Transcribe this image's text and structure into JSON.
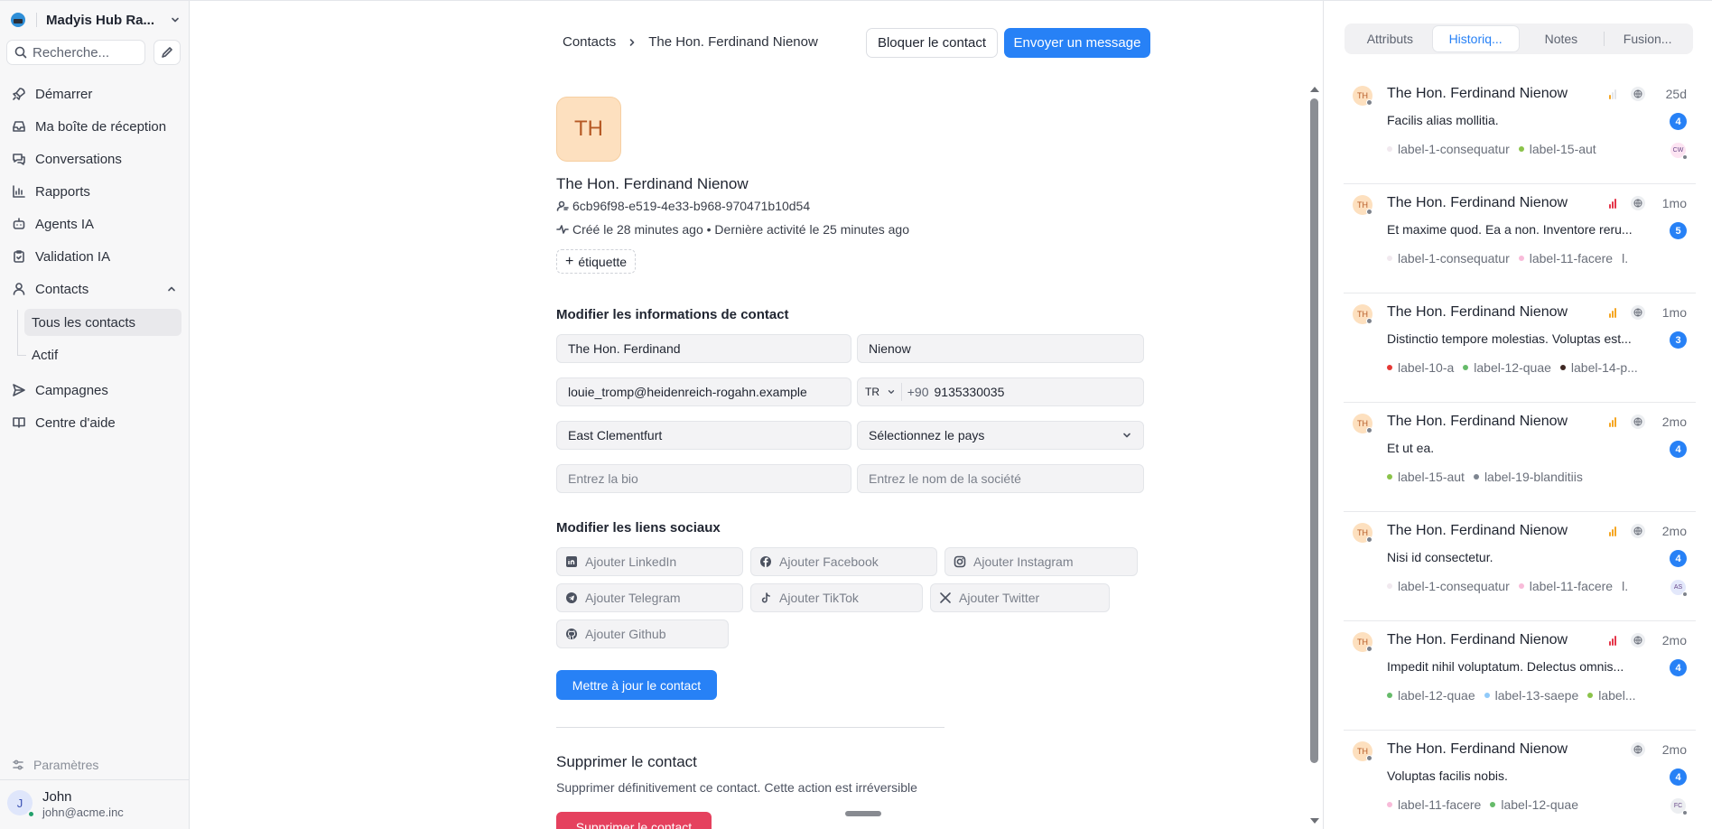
{
  "sidebar": {
    "workspace": "Madyis Hub Ra...",
    "search_placeholder": "Recherche...",
    "nav": [
      {
        "label": "Démarrer",
        "icon": "rocket-icon"
      },
      {
        "label": "Ma boîte de réception",
        "icon": "inbox-icon"
      },
      {
        "label": "Conversations",
        "icon": "conversations-icon"
      },
      {
        "label": "Rapports",
        "icon": "bar-chart-icon"
      },
      {
        "label": "Agents IA",
        "icon": "robot-icon"
      },
      {
        "label": "Validation IA",
        "icon": "clipboard-check-icon"
      },
      {
        "label": "Contacts",
        "icon": "user-icon"
      },
      {
        "label": "Campagnes",
        "icon": "send-icon"
      },
      {
        "label": "Centre d'aide",
        "icon": "book-icon"
      }
    ],
    "contacts_sub": [
      "Tous les contacts",
      "Actif"
    ],
    "settings": "Paramètres",
    "user": {
      "initial": "J",
      "name": "John",
      "email": "john@acme.inc"
    }
  },
  "header": {
    "breadcrumb_root": "Contacts",
    "breadcrumb_current": "The Hon. Ferdinand Nienow",
    "block_label": "Bloquer le contact",
    "message_label": "Envoyer un message"
  },
  "contact": {
    "initials": "TH",
    "name": "The Hon. Ferdinand Nienow",
    "id": "6cb96f98-e519-4e33-b968-970471b10d54",
    "activity": "Créé le 28 minutes ago • Dernière activité le 25 minutes ago",
    "tag_button": "étiquette"
  },
  "form": {
    "title": "Modifier les informations de contact",
    "first_name": "The Hon. Ferdinand",
    "last_name": "Nienow",
    "email": "louie_tromp@heidenreich-rogahn.example",
    "phone_country": "TR",
    "phone_prefix": "+90",
    "phone": "9135330035",
    "city": "East Clementfurt",
    "country_placeholder": "Sélectionnez le pays",
    "bio_placeholder": "Entrez la bio",
    "company_placeholder": "Entrez le nom de la société"
  },
  "social": {
    "title": "Modifier les liens sociaux",
    "linkedin": "Ajouter LinkedIn",
    "facebook": "Ajouter Facebook",
    "instagram": "Ajouter Instagram",
    "telegram": "Ajouter Telegram",
    "tiktok": "Ajouter TikTok",
    "twitter": "Ajouter Twitter",
    "github": "Ajouter Github"
  },
  "update_button": "Mettre à jour le contact",
  "danger": {
    "title": "Supprimer le contact",
    "description": "Supprimer définitivement ce contact. Cette action est irréversible",
    "button": "Supprimer le contact"
  },
  "panel": {
    "tabs": [
      "Attributs",
      "Historiq...",
      "Notes",
      "Fusion..."
    ],
    "active_tab": 1,
    "conversations": [
      {
        "initials": "TH",
        "name": "The Hon. Ferdinand Nienow",
        "priority": "low",
        "time": "25d",
        "message": "Facilis alias mollitia.",
        "count": "4",
        "labels": [
          {
            "text": "label-1-consequatur",
            "color": "#f1e9ef"
          },
          {
            "text": "label-15-aut",
            "color": "#8bc34a"
          }
        ],
        "more": "",
        "assignee": "CW",
        "assignee_color": "#fde4f2"
      },
      {
        "initials": "TH",
        "name": "The Hon. Ferdinand Nienow",
        "priority": "urgent",
        "time": "1mo",
        "message": "Et maxime quod. Ea a non. Inventore reru...",
        "count": "5",
        "labels": [
          {
            "text": "label-1-consequatur",
            "color": "#f1e9ef"
          },
          {
            "text": "label-11-facere",
            "color": "#f8bbd9"
          }
        ],
        "more": "l.",
        "assignee": "",
        "assignee_color": ""
      },
      {
        "initials": "TH",
        "name": "The Hon. Ferdinand Nienow",
        "priority": "high",
        "time": "1mo",
        "message": "Distinctio tempore molestias. Voluptas est...",
        "count": "3",
        "labels": [
          {
            "text": "label-10-a",
            "color": "#e53935"
          },
          {
            "text": "label-12-quae",
            "color": "#66bb6a"
          },
          {
            "text": "label-14-p...",
            "color": "#3e2723"
          }
        ],
        "more": "",
        "assignee": "",
        "assignee_color": ""
      },
      {
        "initials": "TH",
        "name": "The Hon. Ferdinand Nienow",
        "priority": "high",
        "time": "2mo",
        "message": "Et ut ea.",
        "count": "4",
        "labels": [
          {
            "text": "label-15-aut",
            "color": "#8bc34a"
          },
          {
            "text": "label-19-blanditiis",
            "color": "#7e8590"
          }
        ],
        "more": "",
        "assignee": "",
        "assignee_color": ""
      },
      {
        "initials": "TH",
        "name": "The Hon. Ferdinand Nienow",
        "priority": "high",
        "time": "2mo",
        "message": "Nisi id consectetur.",
        "count": "4",
        "labels": [
          {
            "text": "label-1-consequatur",
            "color": "#f1e9ef"
          },
          {
            "text": "label-11-facere",
            "color": "#f8bbd9"
          }
        ],
        "more": "l.",
        "assignee": "AS",
        "assignee_color": "#e3e8fb"
      },
      {
        "initials": "TH",
        "name": "The Hon. Ferdinand Nienow",
        "priority": "urgent",
        "time": "2mo",
        "message": "Impedit nihil voluptatum. Delectus omnis...",
        "count": "4",
        "labels": [
          {
            "text": "label-12-quae",
            "color": "#66bb6a"
          },
          {
            "text": "label-13-saepe",
            "color": "#90caf9"
          },
          {
            "text": "label...",
            "color": "#8bc34a"
          }
        ],
        "more": "",
        "assignee": "",
        "assignee_color": ""
      },
      {
        "initials": "TH",
        "name": "The Hon. Ferdinand Nienow",
        "priority": "none",
        "time": "2mo",
        "message": "Voluptas facilis nobis.",
        "count": "4",
        "labels": [
          {
            "text": "label-11-facere",
            "color": "#f8bbd9"
          },
          {
            "text": "label-12-quae",
            "color": "#66bb6a"
          }
        ],
        "more": "",
        "assignee": "FC",
        "assignee_color": "#eceef1"
      }
    ]
  },
  "colors": {
    "primary": "#2781f6",
    "danger": "#e5415e",
    "prio_high": "#f5a623",
    "prio_urgent": "#e5364a"
  }
}
